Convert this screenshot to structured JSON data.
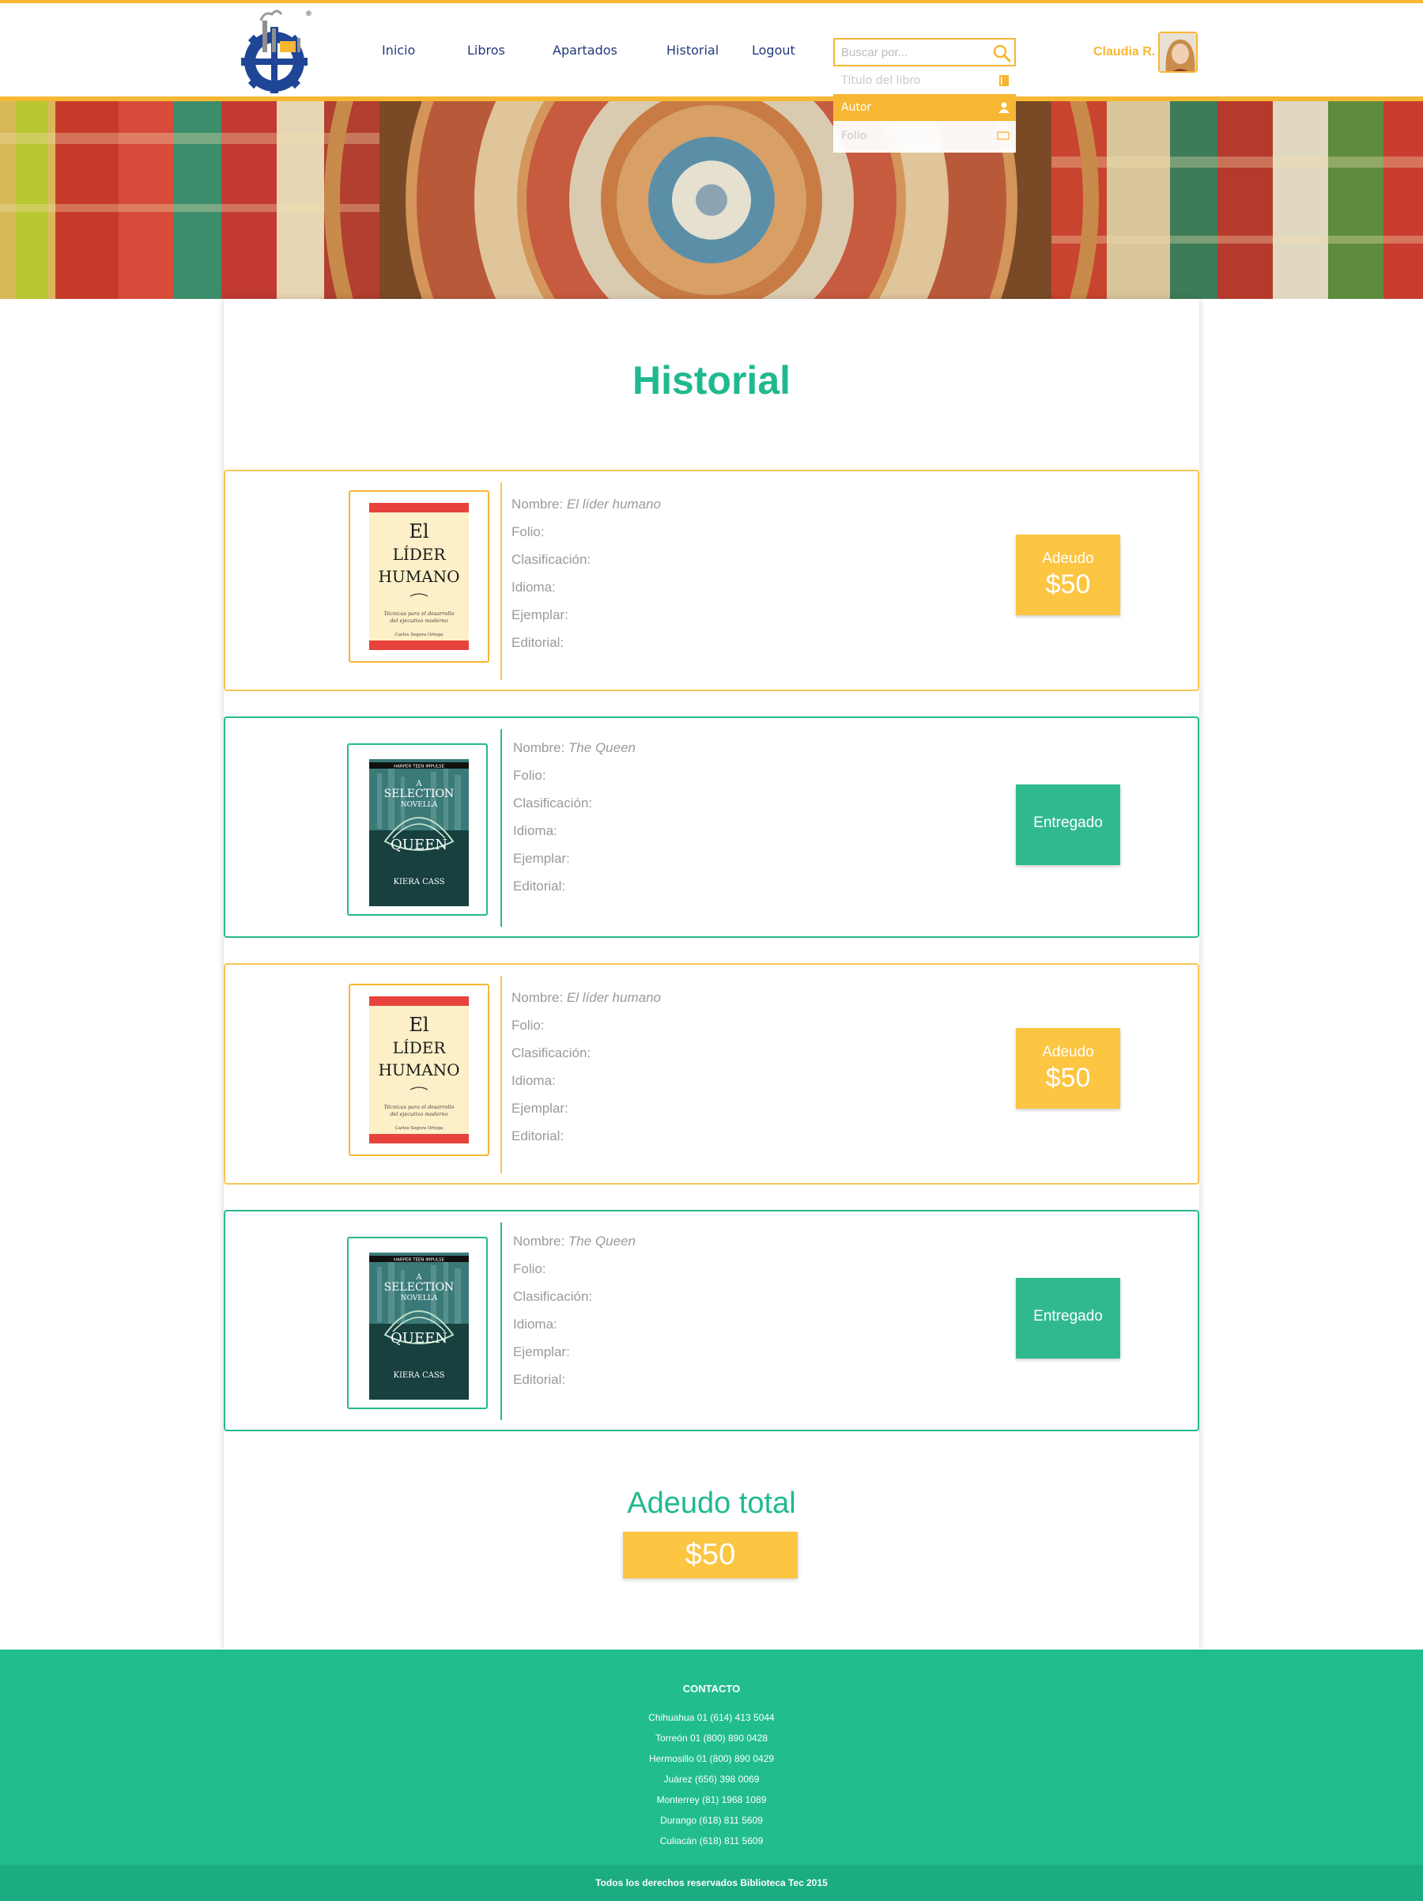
{
  "header": {
    "user_name": "Claudia R.",
    "nav": [
      {
        "label": "Inicio"
      },
      {
        "label": "Libros"
      },
      {
        "label": "Apartados"
      },
      {
        "label": "Historial"
      },
      {
        "label": "Logout"
      }
    ],
    "search": {
      "placeholder": "Buscar por...",
      "options": [
        {
          "label": "Título del libro",
          "icon": "book-icon",
          "selected": false
        },
        {
          "label": "Autor",
          "icon": "user-icon",
          "selected": true
        },
        {
          "label": "Folio",
          "icon": "open-book-icon",
          "selected": false
        }
      ]
    }
  },
  "main": {
    "title": "Historial",
    "field_labels": {
      "name": "Nombre:",
      "folio": "Folio:",
      "clasificacion": "Clasificación:",
      "idioma": "Idioma:",
      "ejemplar": "Ejemplar:",
      "editorial": "Editorial:"
    },
    "entries": [
      {
        "name": "El líder humano",
        "status": "Adeudo",
        "amount": "$50",
        "type": "debt"
      },
      {
        "name": "The Queen",
        "status": "Entregado",
        "amount": "",
        "type": "ok"
      },
      {
        "name": "El líder humano",
        "status": "Adeudo",
        "amount": "$50",
        "type": "debt"
      },
      {
        "name": "The Queen",
        "status": "Entregado",
        "amount": "",
        "type": "ok"
      }
    ],
    "covers": {
      "lider": {
        "line1": "El",
        "line2": "LÍDER",
        "line3": "HUMANO",
        "sub1": "Técnicas para el desarrollo",
        "sub2": "del ejecutivo moderno",
        "author": "Carlos Segura Ortega"
      },
      "queen": {
        "publisher": "HARPER TEEN IMPULSE",
        "series1": "A",
        "series2": "SELECTION",
        "series3": "NOVELLA",
        "title": "QUEEN",
        "author": "KIERA CASS"
      }
    },
    "total": {
      "title": "Adeudo total",
      "amount": "$50"
    }
  },
  "footer": {
    "title": "CONTACTO",
    "contacts": [
      "Chihuahua 01 (614) 413 5044",
      "Torreón 01 (800) 890 0428",
      "Hermosillo 01 (800) 890 0429",
      "Juárez (656) 398 0069",
      "Monterrey (81) 1968 1089",
      "Durango (618) 811 5609",
      "Culiacán (618) 811 5609"
    ],
    "copyright": "Todos los derechos reservados Biblioteca Tec 2015"
  },
  "colors": {
    "accent_orange": "#f7b733",
    "accent_green": "#21bd8f",
    "nav_blue": "#233a7a"
  }
}
